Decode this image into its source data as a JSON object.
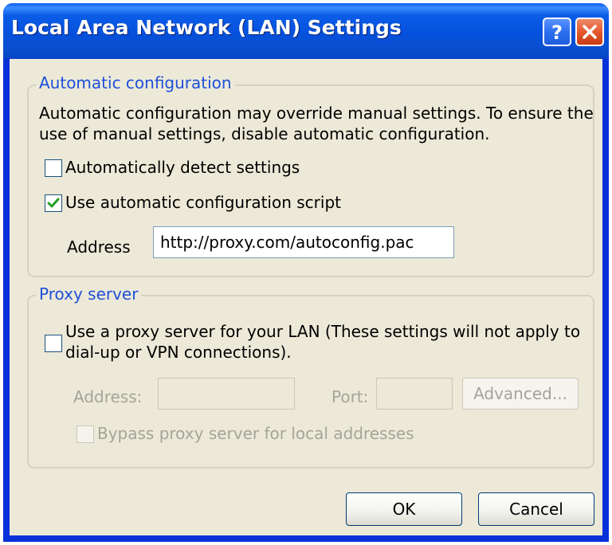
{
  "window": {
    "title": "Local Area Network (LAN) Settings",
    "help_icon": "question-mark-icon",
    "close_icon": "close-x-icon"
  },
  "automatic_configuration": {
    "legend": "Automatic configuration",
    "description_line1": "Automatic configuration may override manual settings.  To ensure the",
    "description_line2": "use of manual settings, disable automatic configuration.",
    "auto_detect": {
      "label": "Automatically detect settings",
      "checked": false
    },
    "use_script": {
      "label": "Use automatic configuration script",
      "checked": true
    },
    "address_label": "Address",
    "address_value": "http://proxy.com/autoconfig.pac"
  },
  "proxy_server": {
    "legend": "Proxy server",
    "use_proxy_line1": "Use a proxy server for your LAN (These settings will not apply to",
    "use_proxy_line2": "dial-up or VPN connections).",
    "use_proxy_checked": false,
    "address_label": "Address:",
    "address_value": "",
    "port_label": "Port:",
    "port_value": "",
    "advanced_label": "Advanced...",
    "bypass_label": "Bypass proxy server for local addresses",
    "bypass_checked": false
  },
  "buttons": {
    "ok": "OK",
    "cancel": "Cancel"
  }
}
